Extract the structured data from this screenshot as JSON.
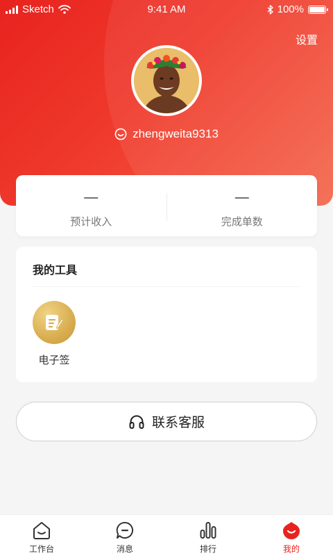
{
  "status_bar": {
    "carrier": "Sketch",
    "time": "9:41 AM",
    "battery": "100%"
  },
  "header": {
    "settings_label": "设置",
    "username": "zhengweita9313"
  },
  "stats": [
    {
      "value": "—",
      "label": "预计收入"
    },
    {
      "value": "—",
      "label": "完成单数"
    }
  ],
  "tools": {
    "title": "我的工具",
    "items": [
      {
        "label": "电子签",
        "icon": "e-sign-icon"
      }
    ]
  },
  "service_button": {
    "label": "联系客服",
    "icon": "headset-icon"
  },
  "tabbar": {
    "items": [
      {
        "label": "工作台",
        "icon": "home-icon",
        "active": false
      },
      {
        "label": "消息",
        "icon": "message-icon",
        "active": false
      },
      {
        "label": "排行",
        "icon": "ranking-icon",
        "active": false
      },
      {
        "label": "我的",
        "icon": "profile-icon",
        "active": true
      }
    ]
  },
  "colors": {
    "brand": "#e8231f",
    "header_gradient_end": "#f4684d",
    "tool_gold": "#d9ad4f",
    "background": "#f5f5f5"
  }
}
